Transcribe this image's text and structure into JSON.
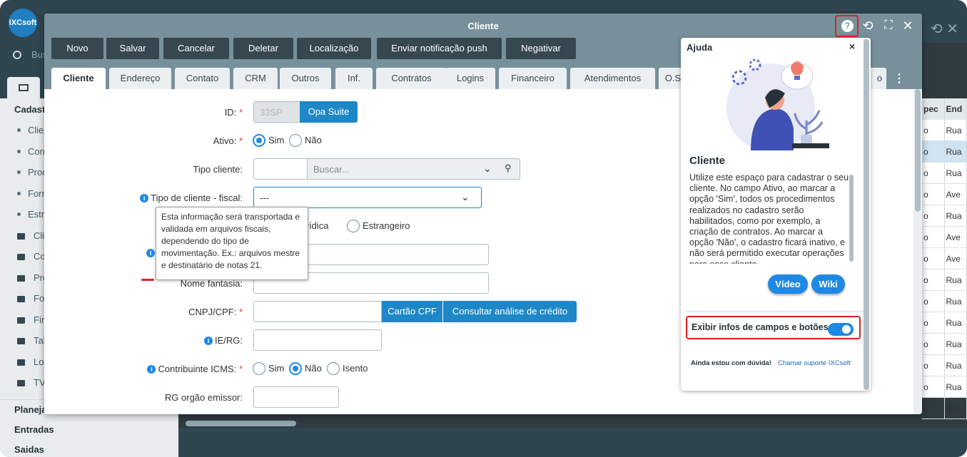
{
  "sidebar": {
    "logo": "IXCsoft",
    "search_placeholder": "Bus",
    "section_title": "Cadast",
    "items": [
      {
        "label": "Clier",
        "type": "dot"
      },
      {
        "label": "Conf",
        "type": "dot"
      },
      {
        "label": "Prod",
        "type": "dot"
      },
      {
        "label": "Forn",
        "type": "dot"
      },
      {
        "label": "Estru",
        "type": "dot"
      },
      {
        "label": "Cli",
        "type": "folder"
      },
      {
        "label": "Co",
        "type": "folder"
      },
      {
        "label": "Pro",
        "type": "folder"
      },
      {
        "label": "For",
        "type": "folder"
      },
      {
        "label": "Fin",
        "type": "folder"
      },
      {
        "label": "Tal",
        "type": "folder"
      },
      {
        "label": "Loc",
        "type": "folder"
      },
      {
        "label": "TV",
        "type": "folder"
      }
    ],
    "bottom": [
      "Planeja",
      "Entradas",
      "Saidas"
    ]
  },
  "bg_table": {
    "headers": [
      "pec",
      "End"
    ],
    "rows": [
      [
        "o",
        "Rua"
      ],
      [
        "o",
        "Rua"
      ],
      [
        "o",
        "Rua"
      ],
      [
        "o",
        "Ave"
      ],
      [
        "o",
        "Rua"
      ],
      [
        "o",
        "Ave"
      ],
      [
        "o",
        "Ave"
      ],
      [
        "o",
        "Rua"
      ],
      [
        "o",
        "Rua"
      ],
      [
        "o",
        "Rua"
      ],
      [
        "o",
        "Rua"
      ],
      [
        "o",
        "Rua"
      ],
      [
        "o",
        "Rua"
      ],
      [
        "o",
        "Rua"
      ]
    ]
  },
  "modal": {
    "title": "Cliente",
    "toolbar": [
      "Novo",
      "Salvar",
      "Cancelar",
      "Deletar",
      "Localização",
      "Enviar notificação push",
      "Negativar"
    ],
    "tabs": [
      "Cliente",
      "Endereço",
      "Contato",
      "CRM",
      "Outros",
      "Inf.",
      "Contratos",
      "Logins",
      "Financeiro",
      "Atendimentos",
      "O.S",
      "o"
    ],
    "active_tab": "Cliente"
  },
  "form": {
    "id_label": "ID:",
    "id_value": "33SP",
    "opa_suite": "Opa Suite",
    "ativo_label": "Ativo:",
    "sim": "Sim",
    "nao": "Não",
    "tipo_cliente_label": "Tipo cliente:",
    "buscar_placeholder": "Buscar...",
    "tipo_fiscal_label": "Tipo de cliente - fiscal:",
    "tipo_fiscal_value": "---",
    "juridica": "Jurídica",
    "estrangeiro": "Estrangeiro",
    "nome_fantasia_label": "Nome fantasia:",
    "cnpj_label": "CNPJ/CPF:",
    "cartao_cpf": "Cartão CPF",
    "consultar_credito": "Consultar análise de crédito",
    "ie_label": "IE/RG:",
    "contribuinte_label": "Contribuinte ICMS:",
    "isento": "Isento",
    "rg_orgao_label": "RG orgão emissor:",
    "tooltip": "Esta informação será transportada e validada em arquivos fiscais, dependendo do tipo de movimentação. Ex.: arquivos mestre e destinatário de notas 21."
  },
  "help_panel": {
    "title": "Ajuda",
    "close": "×",
    "subtitle": "Cliente",
    "text": "Utilize este espaço para cadastrar o seu cliente. No campo Ativo, ao marcar a opção 'Sim', todos os procedimentos realizados no cadastro serão habilitados, como por exemplo, a criação de contratos. Ao marcar a opção 'Não', o cadastro ficará inativo, e não será permitido executar operações para esse cliente.",
    "video": "Vídeo",
    "wiki": "Wiki",
    "toggle_label": "Exibir infos de campos e botões",
    "toggle_on": true,
    "footer": "Ainda estou com dúvida!",
    "support_link": "Chamar suporte IXCsoft"
  },
  "colors": {
    "accent": "#1e88e5",
    "header": "#78909c",
    "highlight": "#e02020"
  }
}
